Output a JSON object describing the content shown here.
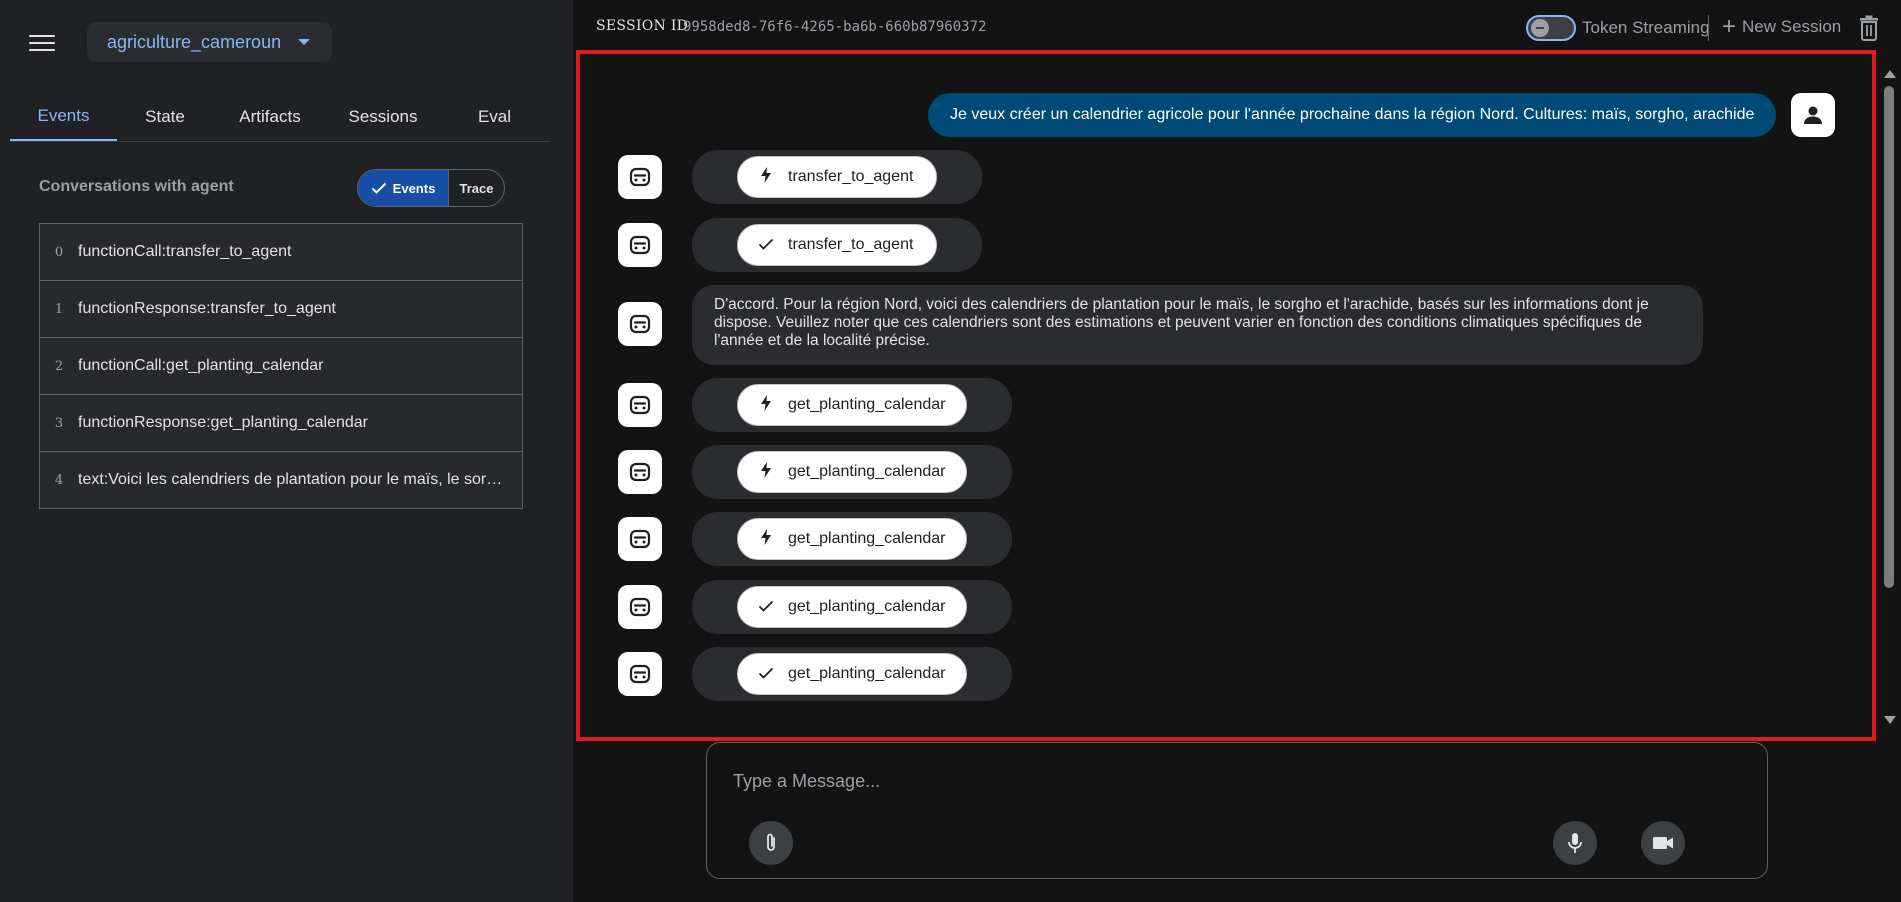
{
  "app": {
    "selected": "agriculture_cameroun"
  },
  "tabs": [
    "Events",
    "State",
    "Artifacts",
    "Sessions",
    "Eval"
  ],
  "conversations": {
    "title": "Conversations with agent",
    "toggle_events": "Events",
    "toggle_trace": "Trace"
  },
  "events": [
    {
      "idx": "0",
      "text": "functionCall:transfer_to_agent"
    },
    {
      "idx": "1",
      "text": "functionResponse:transfer_to_agent"
    },
    {
      "idx": "2",
      "text": "functionCall:get_planting_calendar"
    },
    {
      "idx": "3",
      "text": "functionResponse:get_planting_calendar"
    },
    {
      "idx": "4",
      "text": "text:Voici les calendriers de plantation pour le maïs, le sorgho et l'arachide"
    }
  ],
  "topbar": {
    "session_label": "SESSION ID",
    "session_id": "9958ded8-76f6-4265-ba6b-660b87960372",
    "streaming_label": "Token Streaming",
    "streaming_on": false,
    "new_session": "New Session"
  },
  "chat": {
    "user_message": "Je veux créer un calendrier agricole pour l'année prochaine dans la région Nord. Cultures: maïs, sorgho, arachide",
    "chips": [
      {
        "icon": "bolt-icon",
        "label": "transfer_to_agent"
      },
      {
        "icon": "check-icon",
        "label": "transfer_to_agent"
      },
      {
        "icon": "bolt-icon",
        "label": "get_planting_calendar"
      },
      {
        "icon": "bolt-icon",
        "label": "get_planting_calendar"
      },
      {
        "icon": "bolt-icon",
        "label": "get_planting_calendar"
      },
      {
        "icon": "check-icon",
        "label": "get_planting_calendar"
      },
      {
        "icon": "check-icon",
        "label": "get_planting_calendar"
      }
    ],
    "agent_text": "D'accord. Pour la région Nord, voici des calendriers de plantation pour le maïs, le sorgho et l'arachide, basés sur les informations dont je dispose. Veuillez noter que ces calendriers sont des estimations et peuvent varier en fonction des conditions climatiques spécifiques de l'année et de la localité précise."
  },
  "input": {
    "placeholder": "Type a Message..."
  },
  "colors": {
    "accent": "#8ab4f8",
    "user_bubble": "#004a77",
    "highlight_frame": "#e11b1b"
  }
}
